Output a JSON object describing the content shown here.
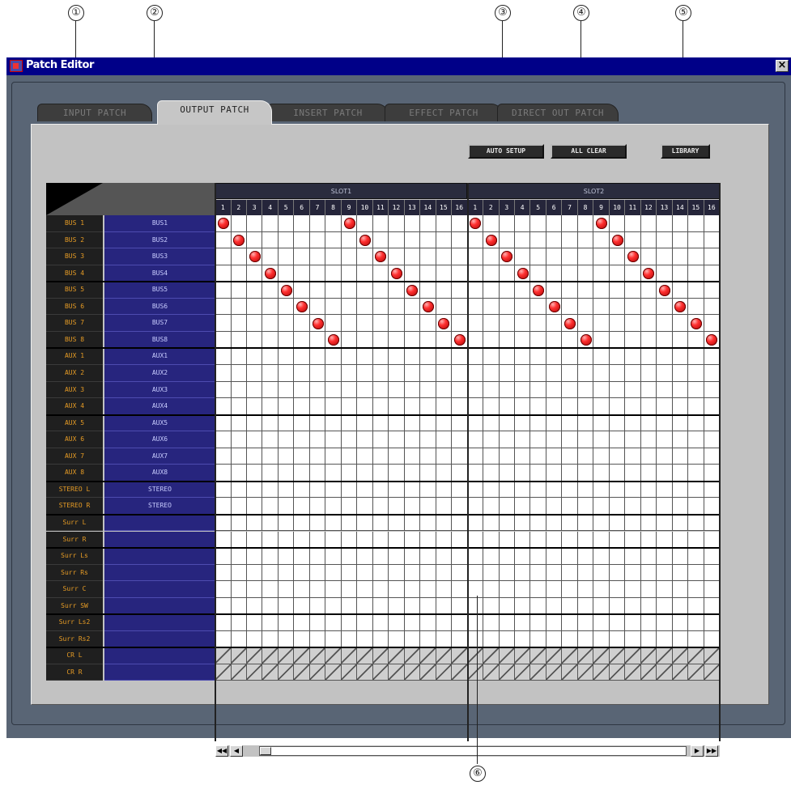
{
  "window": {
    "title": "Patch Editor",
    "close_label": "×"
  },
  "tabs": [
    {
      "label": "INPUT PATCH",
      "active": false
    },
    {
      "label": "OUTPUT PATCH",
      "active": true
    },
    {
      "label": "INSERT PATCH",
      "active": false
    },
    {
      "label": "EFFECT PATCH",
      "active": false
    },
    {
      "label": "DIRECT OUT PATCH",
      "active": false
    }
  ],
  "toolbar": {
    "auto_setup": "AUTO SETUP",
    "all_clear": "ALL CLEAR",
    "library": "LIBRARY"
  },
  "slots": [
    {
      "label": "SLOT1"
    },
    {
      "label": "SLOT2"
    }
  ],
  "columns": [
    "1",
    "2",
    "3",
    "4",
    "5",
    "6",
    "7",
    "8",
    "9",
    "10",
    "11",
    "12",
    "13",
    "14",
    "15",
    "16",
    "1",
    "2",
    "3",
    "4",
    "5",
    "6",
    "7",
    "8",
    "9",
    "10",
    "11",
    "12",
    "13",
    "14",
    "15",
    "16"
  ],
  "rows": [
    {
      "label": "BUS 1",
      "name": "BUS1"
    },
    {
      "label": "BUS 2",
      "name": "BUS2"
    },
    {
      "label": "BUS 3",
      "name": "BUS3"
    },
    {
      "label": "BUS 4",
      "name": "BUS4"
    },
    {
      "label": "BUS 5",
      "name": "BUS5"
    },
    {
      "label": "BUS 6",
      "name": "BUS6"
    },
    {
      "label": "BUS 7",
      "name": "BUS7"
    },
    {
      "label": "BUS 8",
      "name": "BUS8"
    },
    {
      "label": "AUX 1",
      "name": "AUX1"
    },
    {
      "label": "AUX 2",
      "name": "AUX2"
    },
    {
      "label": "AUX 3",
      "name": "AUX3"
    },
    {
      "label": "AUX 4",
      "name": "AUX4"
    },
    {
      "label": "AUX 5",
      "name": "AUX5"
    },
    {
      "label": "AUX 6",
      "name": "AUX6"
    },
    {
      "label": "AUX 7",
      "name": "AUX7"
    },
    {
      "label": "AUX 8",
      "name": "AUX8"
    },
    {
      "label": "STEREO L",
      "name": "STEREO"
    },
    {
      "label": "STEREO R",
      "name": "STEREO"
    },
    {
      "label": "Surr L",
      "name": ""
    },
    {
      "label": "Surr R",
      "name": ""
    },
    {
      "label": "Surr Ls",
      "name": ""
    },
    {
      "label": "Surr Rs",
      "name": ""
    },
    {
      "label": "Surr C",
      "name": ""
    },
    {
      "label": "Surr SW",
      "name": ""
    },
    {
      "label": "Surr Ls2",
      "name": ""
    },
    {
      "label": "Surr Rs2",
      "name": ""
    },
    {
      "label": "CR L",
      "name": ""
    },
    {
      "label": "CR R",
      "name": ""
    }
  ],
  "patches": [
    [
      0,
      0
    ],
    [
      0,
      8
    ],
    [
      0,
      16
    ],
    [
      0,
      24
    ],
    [
      1,
      1
    ],
    [
      1,
      9
    ],
    [
      1,
      17
    ],
    [
      1,
      25
    ],
    [
      2,
      2
    ],
    [
      2,
      10
    ],
    [
      2,
      18
    ],
    [
      2,
      26
    ],
    [
      3,
      3
    ],
    [
      3,
      11
    ],
    [
      3,
      19
    ],
    [
      3,
      27
    ],
    [
      4,
      4
    ],
    [
      4,
      12
    ],
    [
      4,
      20
    ],
    [
      4,
      28
    ],
    [
      5,
      5
    ],
    [
      5,
      13
    ],
    [
      5,
      21
    ],
    [
      5,
      29
    ],
    [
      6,
      6
    ],
    [
      6,
      14
    ],
    [
      6,
      22
    ],
    [
      6,
      30
    ],
    [
      7,
      7
    ],
    [
      7,
      15
    ],
    [
      7,
      23
    ],
    [
      7,
      31
    ]
  ],
  "disabled_rows": [
    26,
    27
  ],
  "callouts": [
    "①",
    "②",
    "③",
    "④",
    "⑤",
    "⑥"
  ],
  "scrollbar": {
    "first": "◀◀",
    "prev": "◀",
    "next": "▶",
    "last": "▶▶"
  },
  "colors": {
    "patch_dot": "#ff3030",
    "title_bar": "#000088",
    "row_label_text": "#e59b25",
    "name_column_bg": "#27257e"
  }
}
